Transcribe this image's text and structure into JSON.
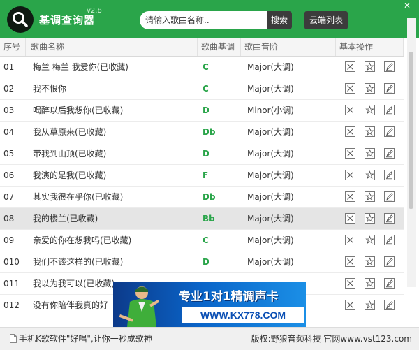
{
  "app": {
    "title": "基调查询器",
    "version": "v2.8",
    "search_placeholder": "请输入歌曲名称..",
    "search_button": "搜索",
    "cloud_button": "云端列表",
    "minimize_glyph": "–",
    "close_glyph": "✕"
  },
  "table": {
    "headers": [
      "序号",
      "歌曲名称",
      "歌曲基调",
      "歌曲音阶",
      "基本操作"
    ],
    "rows": [
      {
        "no": "01",
        "name": "梅兰 梅兰 我爱你(已收藏)",
        "key": "C",
        "scale": "Major(大调)"
      },
      {
        "no": "02",
        "name": "我不恨你",
        "key": "C",
        "scale": "Major(大调)"
      },
      {
        "no": "03",
        "name": "喝醉以后我想你(已收藏)",
        "key": "D",
        "scale": "Minor(小调)"
      },
      {
        "no": "04",
        "name": "我从草原来(已收藏)",
        "key": "Db",
        "scale": "Major(大调)"
      },
      {
        "no": "05",
        "name": "带我到山顶(已收藏)",
        "key": "D",
        "scale": "Major(大调)"
      },
      {
        "no": "06",
        "name": "我演的是我(已收藏)",
        "key": "F",
        "scale": "Major(大调)"
      },
      {
        "no": "07",
        "name": "其实我很在乎你(已收藏)",
        "key": "Db",
        "scale": "Major(大调)"
      },
      {
        "no": "08",
        "name": "我的楼兰(已收藏)",
        "key": "Bb",
        "scale": "Major(大调)",
        "selected": true
      },
      {
        "no": "09",
        "name": "亲爱的你在想我吗(已收藏)",
        "key": "C",
        "scale": "Major(大调)"
      },
      {
        "no": "010",
        "name": "我们不该这样的(已收藏)",
        "key": "D",
        "scale": "Major(大调)"
      },
      {
        "no": "011",
        "name": "我以为我可以(已收藏)",
        "key": "",
        "scale": ""
      },
      {
        "no": "012",
        "name": "没有你陪伴我真的好",
        "key": "",
        "scale": ""
      }
    ]
  },
  "ad": {
    "headline": "专业1对1精调声卡",
    "url": "WWW.KX778.COM"
  },
  "status": {
    "left": "手机K歌软件\"好唱\",让你一秒成歌神",
    "right": "版权:野狼音频科技 官网www.vst123.com"
  },
  "colors": {
    "accent": "#2aa54a",
    "dark_button": "#3c3c3c",
    "selected_row": "#e5e5e5"
  }
}
